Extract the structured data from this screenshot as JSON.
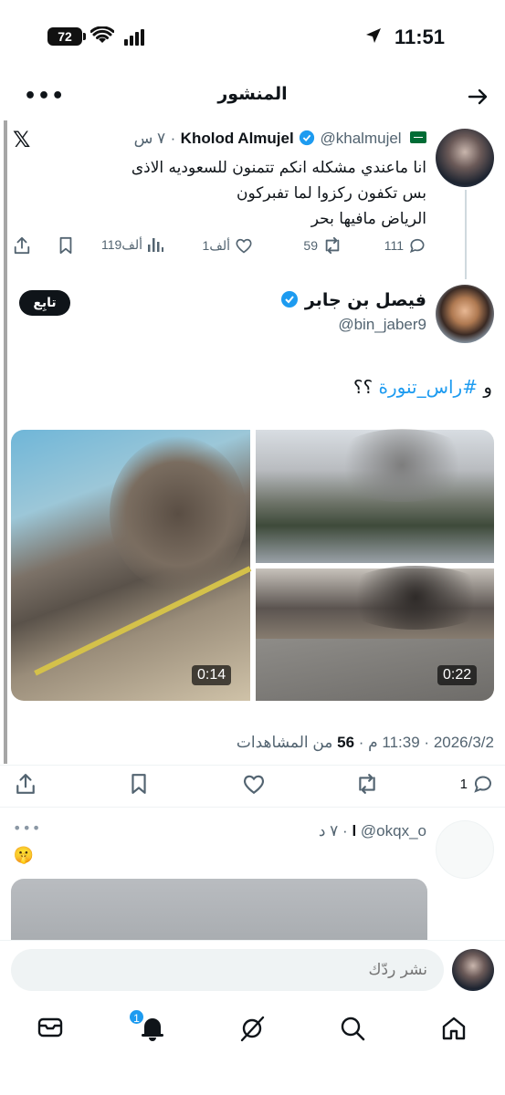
{
  "status_bar": {
    "time": "11:51",
    "battery": "72"
  },
  "header": {
    "title": "المنشور"
  },
  "quoted_post": {
    "name": "Kholod Almujel",
    "handle": "@khalmujel",
    "time": "٧ س",
    "text_lines": [
      "انا ماعندي مشكله انكم تتمنون للسعوديه الاذى",
      "بس تكفون ركزوا لما تفبركون",
      "الرياض مافيها بحر"
    ],
    "replies": "111",
    "reposts": "59",
    "likes": "1ألف",
    "views": "119ألف"
  },
  "main_post": {
    "name": "فيصل بن جابر",
    "handle": "@bin_jaber9",
    "follow_label": "تابِع",
    "text_prefix": "و ",
    "hashtag": "#راس_تنورة",
    "text_suffix": " ؟؟",
    "media": [
      {
        "duration": "0:14"
      },
      {
        "duration": ""
      },
      {
        "duration": "0:22"
      }
    ],
    "date": "2026/3/2",
    "time": "11:39 م",
    "views_count": "56",
    "views_label": "من المشاهدات",
    "replies": "1"
  },
  "reply_post": {
    "name": "l",
    "handle": "@okqx_o",
    "time": "٧ د",
    "emoji": "🤫"
  },
  "composer": {
    "placeholder": "نشر ردّك"
  },
  "tabbar": {
    "notifications_badge": "1"
  },
  "colors": {
    "accent": "#1d9bf0",
    "text": "#0f1419",
    "muted": "#536471"
  }
}
